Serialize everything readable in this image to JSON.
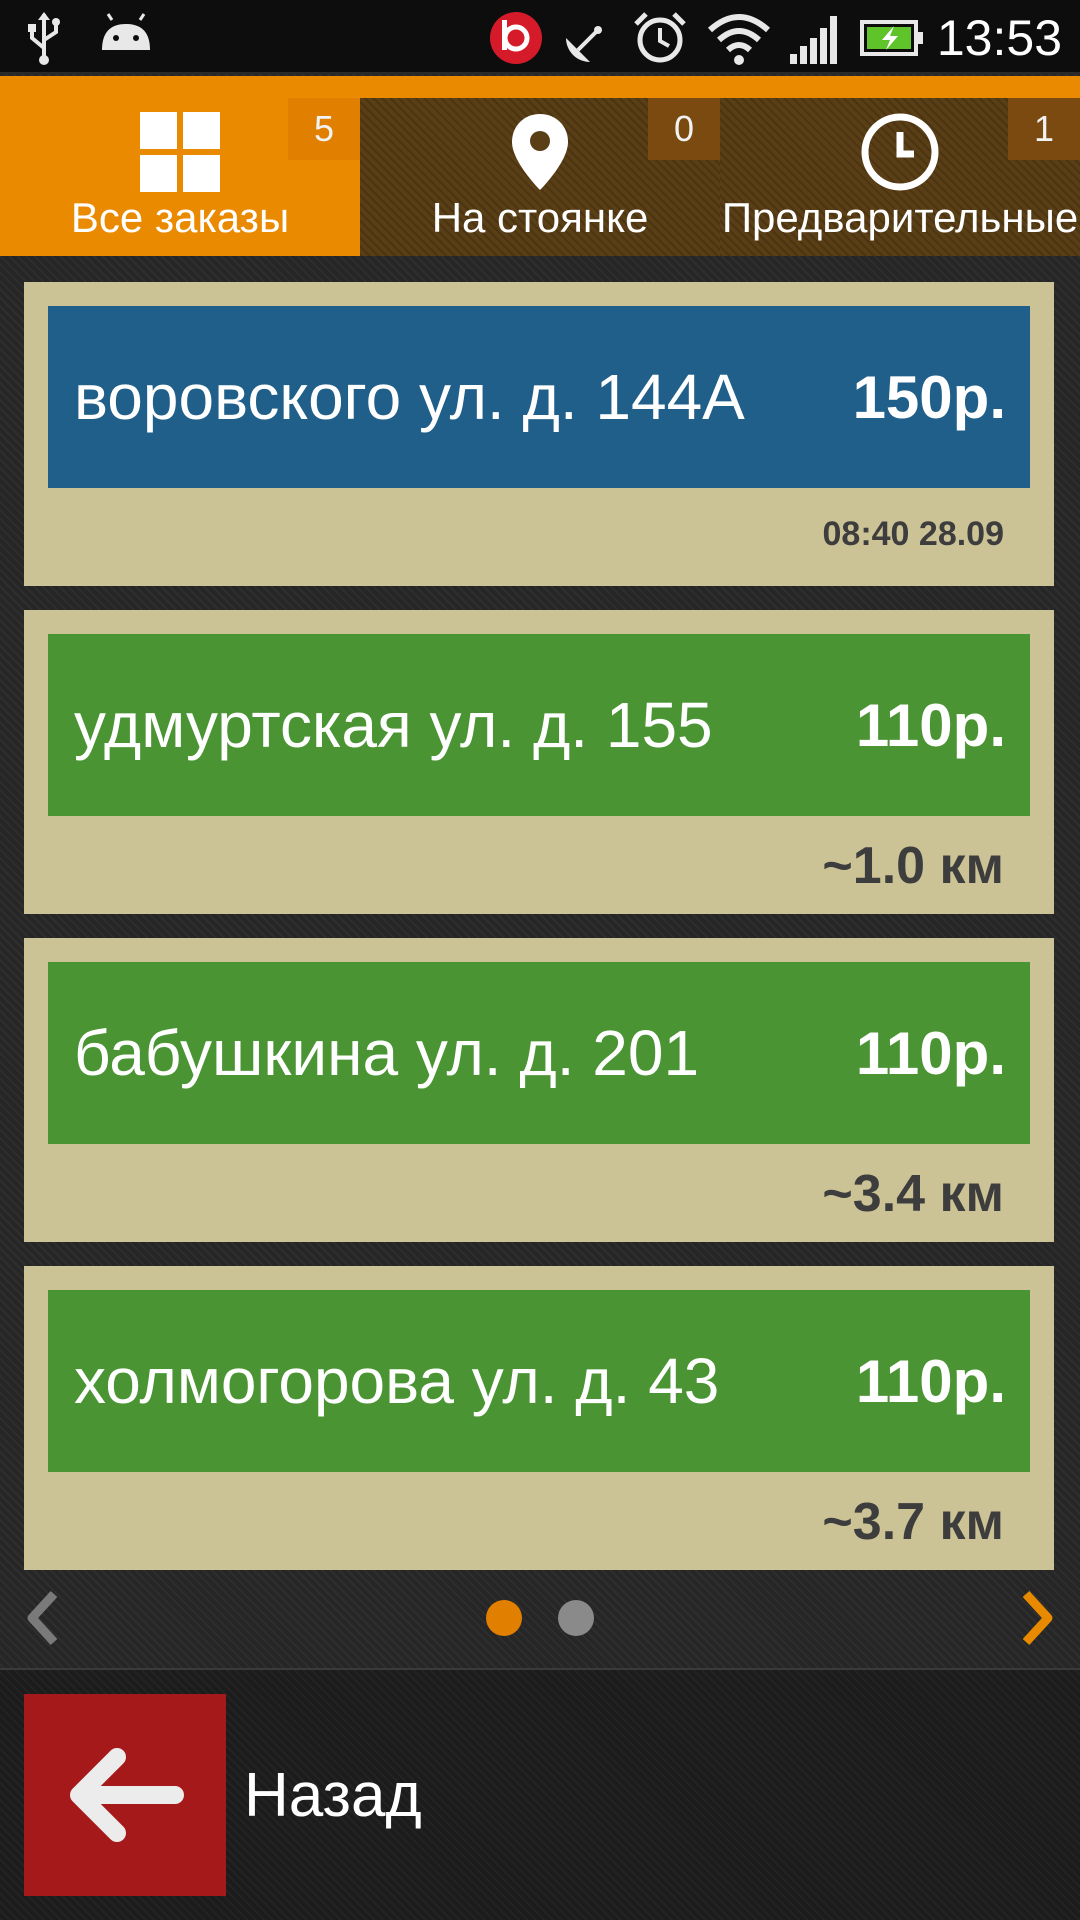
{
  "status_bar": {
    "time": "13:53",
    "icons": [
      "usb-icon",
      "android-icon",
      "beats-icon",
      "satellite-icon",
      "alarm-icon",
      "wifi-icon",
      "signal-icon",
      "battery-charging-icon"
    ]
  },
  "tabs": [
    {
      "label": "Все заказы",
      "count": "5",
      "icon": "grid-icon",
      "active": true
    },
    {
      "label": "На стоянке",
      "count": "0",
      "icon": "map-pin-icon",
      "active": false
    },
    {
      "label": "Предварительные",
      "count": "1",
      "icon": "clock-icon",
      "active": false
    }
  ],
  "orders": [
    {
      "address": "воровского ул. д. 144А",
      "price": "150р.",
      "meta": "08:40 28.09",
      "color": "#1f5f89"
    },
    {
      "address": "удмуртская ул. д. 155",
      "price": "110р.",
      "meta": "~1.0 км",
      "color": "#4a9433"
    },
    {
      "address": "бабушкина ул. д. 201",
      "price": "110р.",
      "meta": "~3.4 км",
      "color": "#4a9433"
    },
    {
      "address": "холмогорова ул. д. 43",
      "price": "110р.",
      "meta": "~3.7 км",
      "color": "#4a9433"
    }
  ],
  "pager": {
    "current_page": 1,
    "total_pages": 2,
    "active_color": "#e07f00"
  },
  "bottom": {
    "back_label": "Назад"
  },
  "colors": {
    "accent": "#ea8a00",
    "back_button": "#a6191a",
    "card_bg": "#cbc295"
  }
}
